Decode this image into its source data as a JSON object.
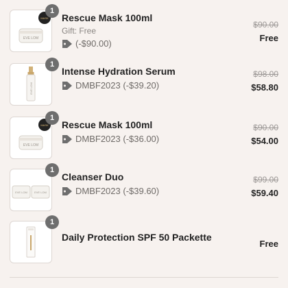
{
  "items": [
    {
      "qty": "1",
      "name": "Rescue Mask 100ml",
      "gift": "Gift: Free",
      "discount": "(-$90.00)",
      "original_price": "$90.00",
      "final_price": "Free",
      "thumb_icon": "jar-icon"
    },
    {
      "qty": "1",
      "name": "Intense Hydration Serum",
      "discount": "DMBF2023 (-$39.20)",
      "original_price": "$98.00",
      "final_price": "$58.80",
      "thumb_icon": "serum-bottle-icon"
    },
    {
      "qty": "1",
      "name": "Rescue Mask 100ml",
      "discount": "DMBF2023 (-$36.00)",
      "original_price": "$90.00",
      "final_price": "$54.00",
      "thumb_icon": "jar-icon"
    },
    {
      "qty": "1",
      "name": "Cleanser Duo",
      "discount": "DMBF2023 (-$39.60)",
      "original_price": "$99.00",
      "final_price": "$59.40",
      "thumb_icon": "duo-jars-icon"
    },
    {
      "qty": "1",
      "name": "Daily Protection SPF 50 Packette",
      "final_price": "Free",
      "thumb_icon": "sachet-icon"
    }
  ],
  "colors": {
    "background": "#f7f2ef",
    "badge": "#6e6e6e",
    "text": "#222222",
    "muted": "#8a8683"
  }
}
